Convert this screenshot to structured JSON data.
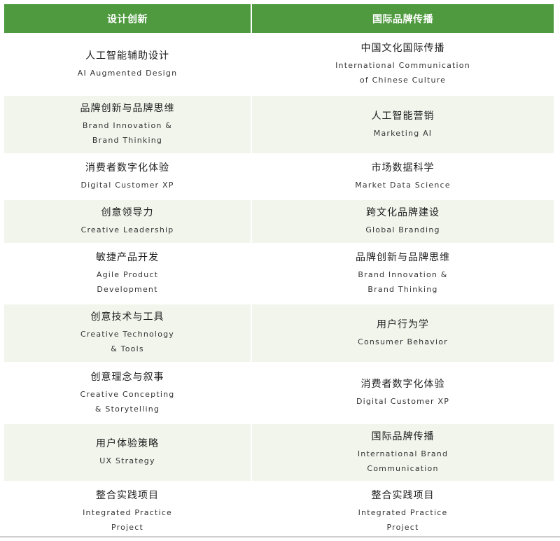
{
  "header": {
    "left": "设计创新",
    "right": "国际品牌传播"
  },
  "rows": [
    {
      "left": {
        "zh": "人工智能辅助设计",
        "en": "AI Augmented Design"
      },
      "right": {
        "zh": "中国文化国际传播",
        "en": "International Communication\nof Chinese Culture"
      }
    },
    {
      "left": {
        "zh": "品牌创新与品牌思维",
        "en": "Brand Innovation &\nBrand Thinking"
      },
      "right": {
        "zh": "人工智能营销",
        "en": "Marketing AI"
      }
    },
    {
      "left": {
        "zh": "消费者数字化体验",
        "en": "Digital Customer XP"
      },
      "right": {
        "zh": "市场数据科学",
        "en": "Market Data Science"
      }
    },
    {
      "left": {
        "zh": "创意领导力",
        "en": "Creative Leadership"
      },
      "right": {
        "zh": "跨文化品牌建设",
        "en": "Global Branding"
      }
    },
    {
      "left": {
        "zh": "敏捷产品开发",
        "en": "Agile Product\nDevelopment"
      },
      "right": {
        "zh": "品牌创新与品牌思维",
        "en": "Brand Innovation &\nBrand Thinking"
      }
    },
    {
      "left": {
        "zh": "创意技术与工具",
        "en": "Creative Technology\n& Tools"
      },
      "right": {
        "zh": "用户行为学",
        "en": "Consumer Behavior"
      }
    },
    {
      "left": {
        "zh": "创意理念与叙事",
        "en": "Creative Concepting\n& Storytelling"
      },
      "right": {
        "zh": "消费者数字化体验",
        "en": "Digital Customer XP"
      }
    },
    {
      "left": {
        "zh": "用户体验策略",
        "en": "UX Strategy"
      },
      "right": {
        "zh": "国际品牌传播",
        "en": "International Brand\nCommunication"
      }
    },
    {
      "left": {
        "zh": "整合实践项目",
        "en": "Integrated Practice\nProject"
      },
      "right": {
        "zh": "整合实践项目",
        "en": "Integrated Practice\nProject"
      }
    }
  ],
  "colors": {
    "header_bg": "#4f9a3f",
    "shade_bg": "#f1f5ec"
  }
}
